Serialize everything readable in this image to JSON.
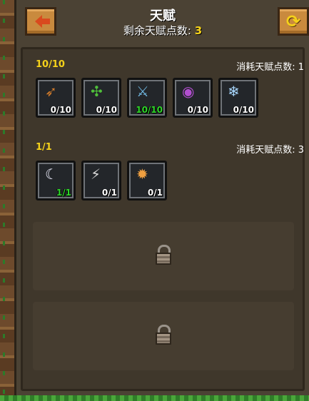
{
  "header": {
    "title": "天赋",
    "subtitle_label": "剩余天赋点数: ",
    "points_remaining": "3",
    "back_icon": "arrow-left-icon",
    "refresh_icon": "refresh-icon"
  },
  "tiers": [
    {
      "progress": "10/10",
      "cost_label": "消耗天赋点数: 1",
      "talents": [
        {
          "icon": "crossbow-icon",
          "glyph": "➶",
          "color": "#d07a2a",
          "count": "0/10",
          "maxed": false
        },
        {
          "icon": "plant-cross-icon",
          "glyph": "✣",
          "color": "#4fbf3a",
          "count": "0/10",
          "maxed": false
        },
        {
          "icon": "sword-icon",
          "glyph": "⚔",
          "color": "#6fb6e0",
          "count": "10/10",
          "maxed": true
        },
        {
          "icon": "swirl-orb-icon",
          "glyph": "◉",
          "color": "#b24fd0",
          "count": "0/10",
          "maxed": false
        },
        {
          "icon": "snowflake-banner-icon",
          "glyph": "❄",
          "color": "#a8d8ff",
          "count": "0/10",
          "maxed": false
        }
      ]
    },
    {
      "progress": "1/1",
      "cost_label": "消耗天赋点数: 3",
      "talents": [
        {
          "icon": "crescent-slash-icon",
          "glyph": "☾",
          "color": "#f0f0ff",
          "count": "1/1",
          "maxed": true
        },
        {
          "icon": "lightning-shard-icon",
          "glyph": "⚡",
          "color": "#d8d8d8",
          "count": "0/1",
          "maxed": false
        },
        {
          "icon": "fire-burst-icon",
          "glyph": "✹",
          "color": "#f0a040",
          "count": "0/1",
          "maxed": false
        }
      ]
    }
  ],
  "locked_tiers": [
    {
      "icon": "padlock-icon"
    },
    {
      "icon": "padlock-icon"
    }
  ]
}
